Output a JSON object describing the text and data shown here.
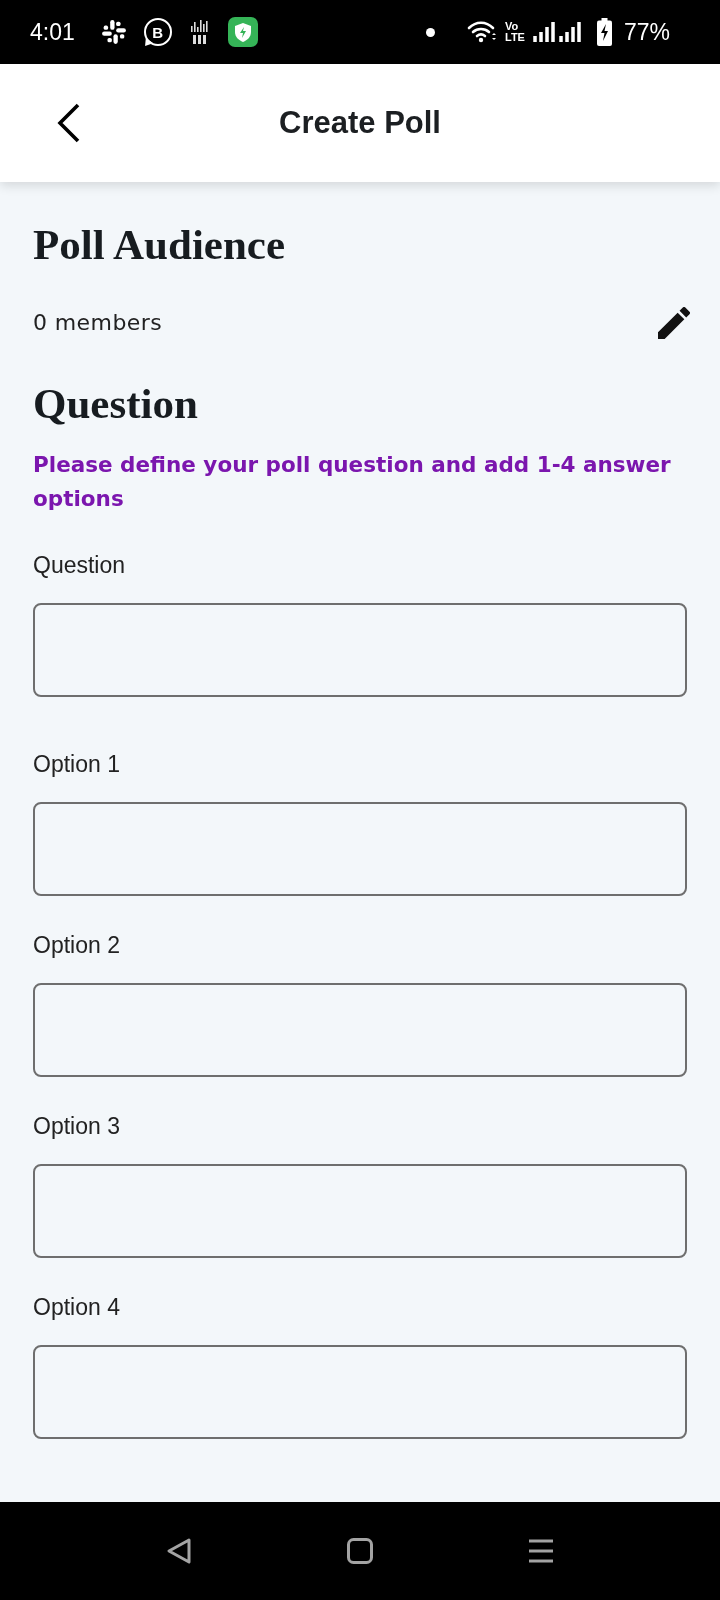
{
  "status_bar": {
    "time": "4:01",
    "chat_letter": "B",
    "network_type_top": "Vo",
    "network_type_bottom": "LTE",
    "battery": "77%"
  },
  "app_bar": {
    "title": "Create Poll"
  },
  "audience": {
    "heading": "Poll Audience",
    "members": "0 members"
  },
  "question_section": {
    "heading": "Question",
    "hint": "Please define your poll question and add 1-4 answer options"
  },
  "fields": [
    {
      "label": "Question"
    },
    {
      "label": "Option 1"
    },
    {
      "label": "Option 2"
    },
    {
      "label": "Option 3"
    },
    {
      "label": "Option 4"
    }
  ]
}
